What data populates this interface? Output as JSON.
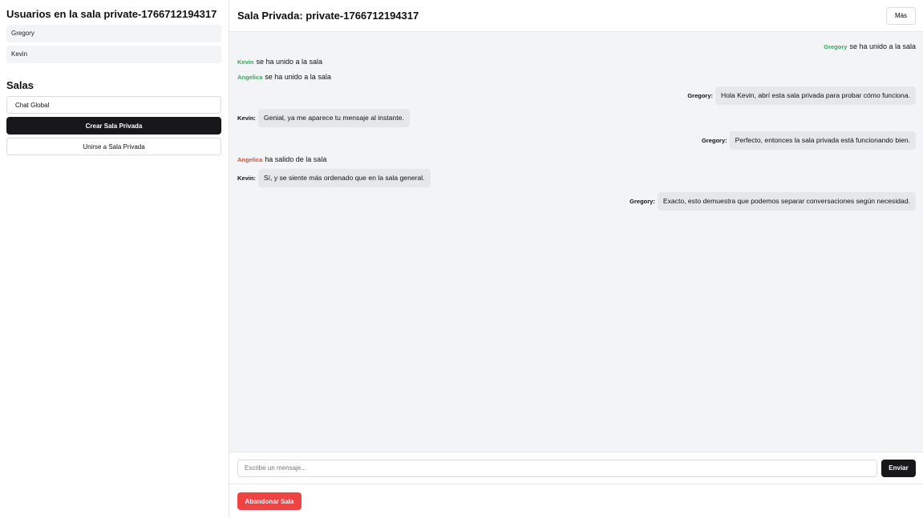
{
  "sidebar": {
    "users_title": "Usuarios en la sala private-1766712194317",
    "users": [
      {
        "name": "Gregory"
      },
      {
        "name": "Kevin"
      }
    ],
    "rooms_title": "Salas",
    "rooms": {
      "global": "Chat Global",
      "create_private": "Crear Sala Privada",
      "join_private": "Unirse a Sala Privada"
    }
  },
  "header": {
    "title": "Sala Privada: private-1766712194317",
    "more_label": "Más"
  },
  "messages": [
    {
      "kind": "system",
      "align": "right",
      "user": "Gregory",
      "user_color": "#3aa55d",
      "text": "se ha unido a la sala"
    },
    {
      "kind": "system",
      "align": "left",
      "user": "Kevin",
      "user_color": "#3aa55d",
      "text": "se ha unido a la sala"
    },
    {
      "kind": "system",
      "align": "left",
      "user": "Angelica",
      "user_color": "#3aa55d",
      "text": "se ha unido a la sala"
    },
    {
      "kind": "chat",
      "align": "right",
      "user": "Gregory:",
      "text": "Hola Kevin, abrí esta sala privada para probar cómo funciona."
    },
    {
      "kind": "chat",
      "align": "left",
      "user": "Kevin:",
      "text": "Genial, ya me aparece tu mensaje al instante."
    },
    {
      "kind": "chat",
      "align": "right",
      "user": "Gregory:",
      "text": "Perfecto, entonces la sala privada está funcionando bien."
    },
    {
      "kind": "system",
      "align": "left",
      "user": "Angelica",
      "user_color": "#d1503f",
      "text": "ha salido de la sala"
    },
    {
      "kind": "chat",
      "align": "left",
      "user": "Kevin:",
      "text": "Sí, y se siente más ordenado que en la sala general."
    },
    {
      "kind": "chat",
      "align": "right",
      "user": "Gregory:",
      "text": "Exacto, esto demuestra que podemos separar conversaciones según necesidad."
    }
  ],
  "composer": {
    "placeholder": "Escribe un mensaje...",
    "value": "",
    "send_label": "Enviar"
  },
  "footer": {
    "leave_label": "Abandonar Sala"
  },
  "colors": {
    "join": "#3aa55d",
    "leave": "#d1503f",
    "primary": "#18181b",
    "danger": "#ef4444"
  }
}
